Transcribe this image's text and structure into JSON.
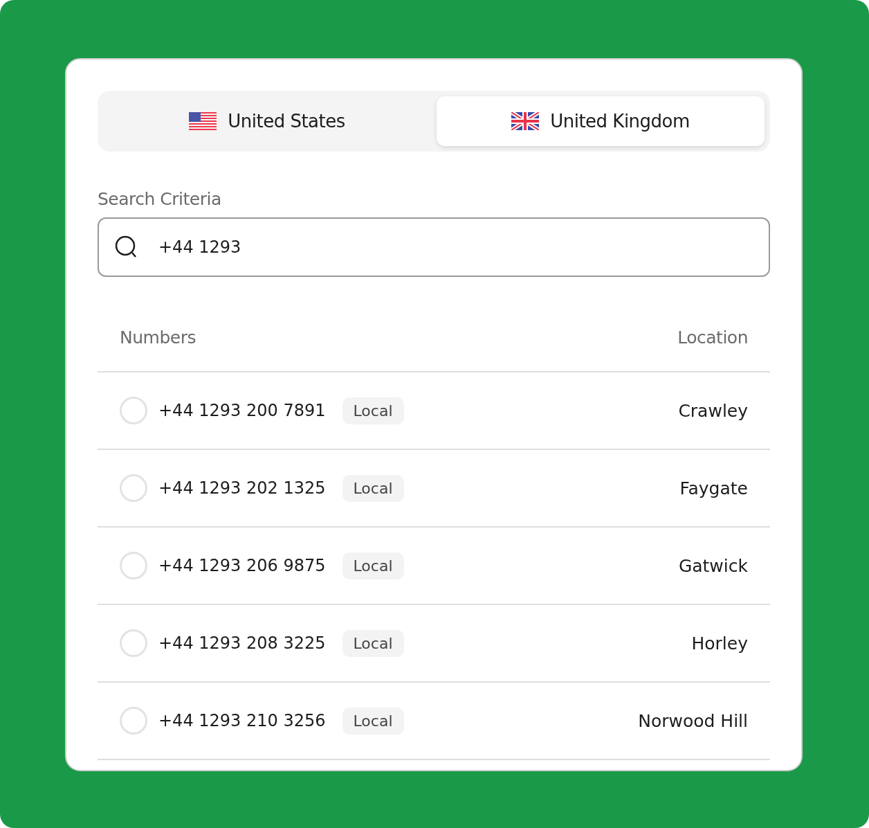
{
  "tabs": [
    {
      "label": "United States",
      "kind": "us",
      "selected": false
    },
    {
      "label": "United Kingdom",
      "kind": "uk",
      "selected": true
    }
  ],
  "search": {
    "label": "Search Criteria",
    "value": "+44 1293"
  },
  "table": {
    "columns": [
      "Numbers",
      "Location"
    ],
    "rows": [
      {
        "number": "+44 1293 200 7891",
        "badge": "Local",
        "location": "Crawley",
        "selected": false
      },
      {
        "number": "+44 1293 202 1325",
        "badge": "Local",
        "location": "Faygate",
        "selected": false
      },
      {
        "number": "+44 1293 206 9875",
        "badge": "Local",
        "location": "Gatwick",
        "selected": false
      },
      {
        "number": "+44 1293 208 3225",
        "badge": "Local",
        "location": "Horley",
        "selected": false
      },
      {
        "number": "+44 1293 210 3256",
        "badge": "Local",
        "location": "Norwood Hill",
        "selected": false
      }
    ]
  }
}
